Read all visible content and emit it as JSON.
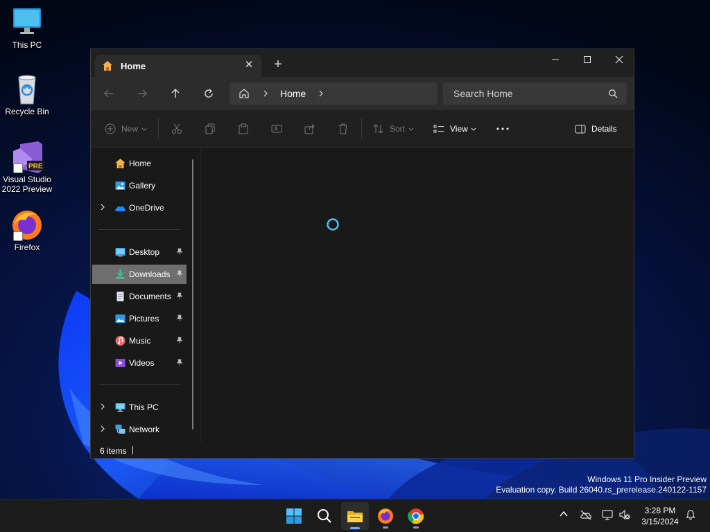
{
  "desktop": {
    "icons": [
      {
        "label": "This PC",
        "icon": "monitor-icon"
      },
      {
        "label": "Recycle Bin",
        "icon": "recycle-bin-icon"
      },
      {
        "label": "Visual Studio 2022 Preview",
        "icon": "visual-studio-icon",
        "badge": "PRE"
      },
      {
        "label": "Firefox",
        "icon": "firefox-icon"
      }
    ],
    "watermark": {
      "line1": "Windows 11 Pro Insider Preview",
      "line2": "Evaluation copy. Build 26040.rs_prerelease.240122-1157"
    }
  },
  "explorer": {
    "tab": {
      "title": "Home",
      "close": "✕",
      "new_tab": "+"
    },
    "address": {
      "crumb": "Home"
    },
    "search": {
      "placeholder": "Search Home"
    },
    "commands": {
      "new": "New",
      "sort": "Sort",
      "view": "View",
      "details": "Details"
    },
    "sidebar": {
      "top": [
        {
          "label": "Home",
          "icon": "home-icon"
        },
        {
          "label": "Gallery",
          "icon": "gallery-icon"
        },
        {
          "label": "OneDrive",
          "icon": "onedrive-icon",
          "expandable": true
        }
      ],
      "quick_access": [
        {
          "label": "Desktop",
          "icon": "desktop-folder-icon",
          "pinned": true
        },
        {
          "label": "Downloads",
          "icon": "downloads-folder-icon",
          "pinned": true,
          "selected": true
        },
        {
          "label": "Documents",
          "icon": "documents-folder-icon",
          "pinned": true
        },
        {
          "label": "Pictures",
          "icon": "pictures-folder-icon",
          "pinned": true
        },
        {
          "label": "Music",
          "icon": "music-folder-icon",
          "pinned": true
        },
        {
          "label": "Videos",
          "icon": "videos-folder-icon",
          "pinned": true
        }
      ],
      "bottom": [
        {
          "label": "This PC",
          "icon": "this-pc-icon",
          "expandable": true
        },
        {
          "label": "Network",
          "icon": "network-icon",
          "expandable": true
        }
      ]
    },
    "status": {
      "item_count": "6 items"
    }
  },
  "taskbar": {
    "apps": [
      "start-icon",
      "search-icon",
      "file-explorer-icon",
      "firefox-icon",
      "chrome-icon"
    ],
    "active_app": "file-explorer-icon",
    "clock": {
      "time": "3:28 PM",
      "date": "3/15/2024"
    }
  },
  "colors": {
    "accent": "#4cc2ff",
    "window_bg": "#191919",
    "selected_bg": "#6e6e6e",
    "taskbar_bg": "#1c1c1c"
  }
}
